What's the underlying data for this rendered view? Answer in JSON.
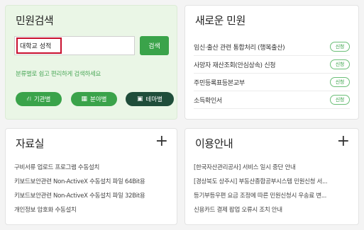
{
  "search_panel": {
    "title": "민원검색",
    "input_value": "대학교 성적",
    "search_button": "검색",
    "description": "분류별로 쉽고 편리하게 검색하세요",
    "categories": [
      {
        "label": "기관별",
        "icon": "org-chart-icon"
      },
      {
        "label": "분야별",
        "icon": "grid-icon"
      },
      {
        "label": "테마별",
        "icon": "theme-icon"
      }
    ],
    "colors": {
      "primary_green": "#3aa34a",
      "dark_green": "#1f4d3a",
      "highlight_red": "#c8102e"
    }
  },
  "new_services": {
    "title": "새로운 민원",
    "badge_label": "신청",
    "items": [
      "임신·출산 관련 통합처리 (행복출산)",
      "사망자 재산조회(안심상속) 신청",
      "주민등록표등본교부",
      "소득확인서"
    ]
  },
  "resources": {
    "title": "자료실",
    "more": "+",
    "items": [
      "구비서류 업로드 프로그램 수동설치",
      "키보드보안관련 Non-ActiveX 수동설치 파일 64Bit용",
      "키보드보안관련 Non-ActiveX 수동설치 파일 32Bit용",
      "개인정보 암호화 수동설치"
    ]
  },
  "usage_guide": {
    "title": "이용안내",
    "more": "+",
    "items": [
      "[한국자산관리공사] 서비스 일시 중단 안내",
      "[경상북도 상주시] 부동산종합공부시스템 민원신청 서...",
      "등기부등우편 요금 조정에 따른 민원신청시 우송료 변...",
      "신용카드 결제 팝업 오류시 조치 안내"
    ]
  }
}
